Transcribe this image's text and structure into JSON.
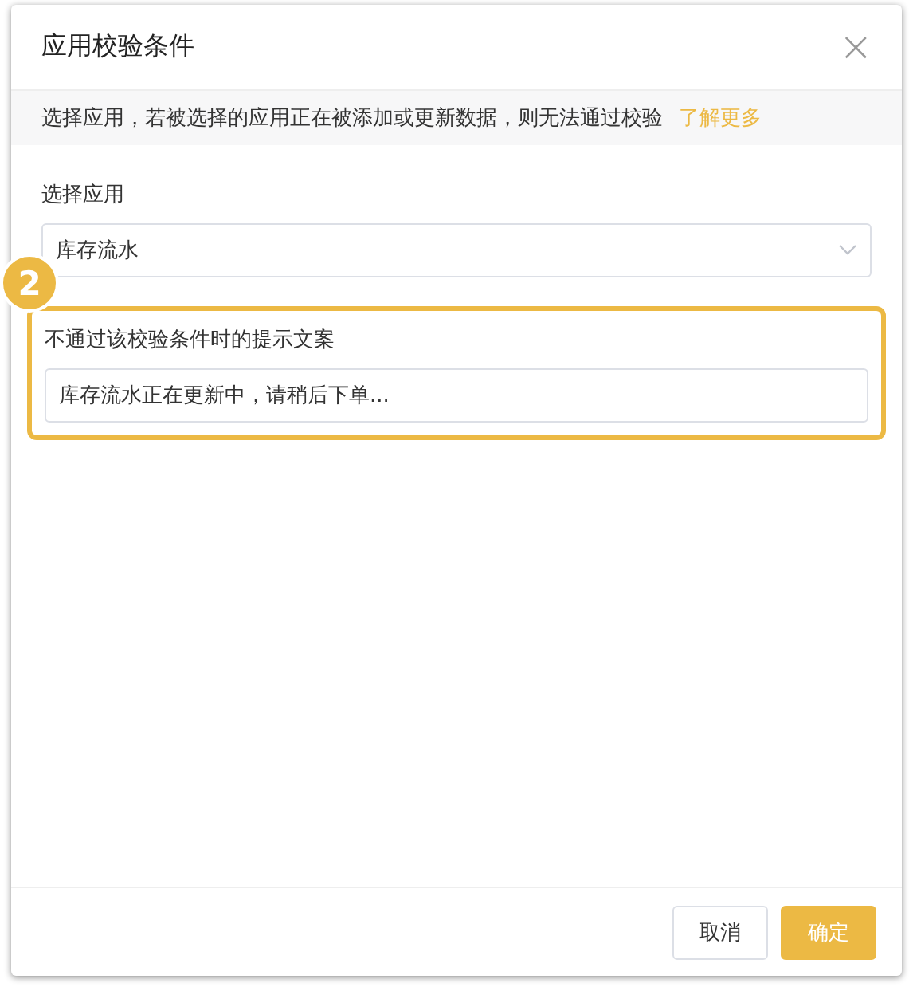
{
  "dialog": {
    "title": "应用校验条件",
    "close_icon": "×"
  },
  "notice": {
    "text": "选择应用，若被选择的应用正在被添加或更新数据，则无法通过校验",
    "link": "了解更多"
  },
  "fields": [
    {
      "kind": "select",
      "label": "选择应用",
      "value": "库存流水",
      "highlighted": false
    },
    {
      "kind": "text",
      "label": "不通过该校验条件时的提示文案",
      "value": "库存流水正在更新中，请稍后下单...",
      "highlighted": true,
      "step_badge": "2"
    }
  ],
  "buttons": [
    {
      "label": "取消",
      "kind": "default"
    },
    {
      "label": "确定",
      "kind": "primary"
    }
  ]
}
